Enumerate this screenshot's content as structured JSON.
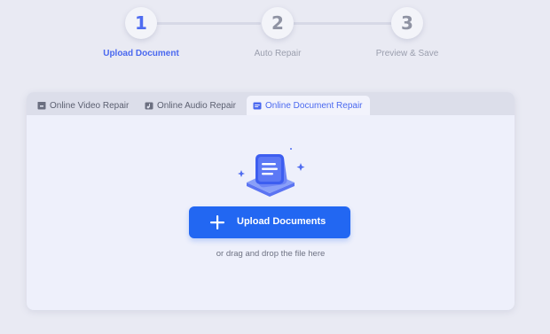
{
  "steps": [
    {
      "number": "1",
      "label": "Upload Document",
      "active": true
    },
    {
      "number": "2",
      "label": "Auto Repair",
      "active": false
    },
    {
      "number": "3",
      "label": "Preview & Save",
      "active": false
    }
  ],
  "tabs": [
    {
      "label": "Online Video Repair",
      "icon": "video-icon"
    },
    {
      "label": "Online Audio Repair",
      "icon": "audio-icon"
    },
    {
      "label": "Online Document Repair",
      "icon": "document-icon",
      "selected": true
    }
  ],
  "upload": {
    "button_label": "Upload Documents",
    "button_icon": "plus-icon",
    "drag_hint": "or drag and drop the file here",
    "illustration_icon": "document-illustration-icon"
  },
  "colors": {
    "accent": "#4a68ef",
    "button": "#2267f2",
    "background": "#e9eaf3"
  }
}
